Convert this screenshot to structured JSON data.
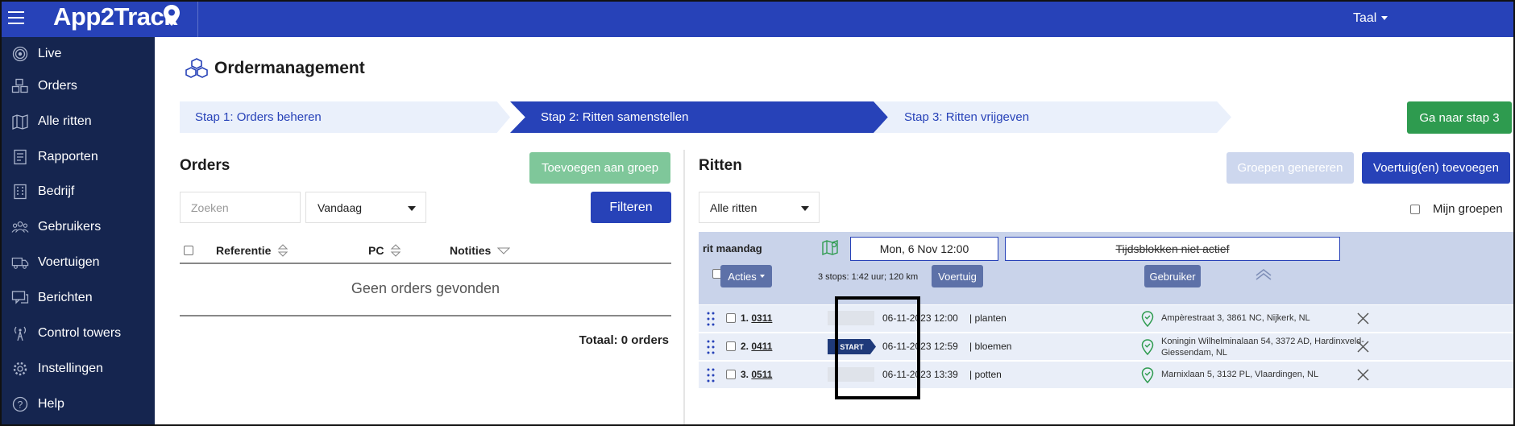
{
  "app": {
    "brand": "App2Track",
    "language_label": "Taal"
  },
  "sidebar": {
    "items": [
      {
        "label": "Live",
        "icon": "live-icon"
      },
      {
        "label": "Orders",
        "icon": "orders-icon"
      },
      {
        "label": "Alle ritten",
        "icon": "map-icon"
      },
      {
        "label": "Rapporten",
        "icon": "reports-icon"
      },
      {
        "label": "Bedrijf",
        "icon": "building-icon"
      },
      {
        "label": "Gebruikers",
        "icon": "users-icon"
      },
      {
        "label": "Voertuigen",
        "icon": "truck-icon"
      },
      {
        "label": "Berichten",
        "icon": "messages-icon"
      },
      {
        "label": "Control towers",
        "icon": "tower-icon"
      },
      {
        "label": "Instellingen",
        "icon": "gear-icon"
      },
      {
        "label": "Help",
        "icon": "help-icon"
      }
    ]
  },
  "page": {
    "title": "Ordermanagement"
  },
  "stepper": {
    "step1": "Stap 1: Orders beheren",
    "step2": "Stap 2: Ritten samenstellen",
    "step3": "Stap 3: Ritten vrijgeven",
    "next_button": "Ga naar stap 3",
    "active": 2
  },
  "orders": {
    "title": "Orders",
    "add_group_button": "Toevoegen aan groep",
    "search_placeholder": "Zoeken",
    "date_filter": "Vandaag",
    "filter_button": "Filteren",
    "columns": [
      "Referentie",
      "PC",
      "Notities"
    ],
    "empty_text": "Geen orders gevonden",
    "total": "Totaal: 0 orders"
  },
  "ritten": {
    "title": "Ritten",
    "generate_button": "Groepen genereren",
    "add_vehicle_button": "Voertuig(en) toevoegen",
    "filter": "Alle ritten",
    "my_groups_label": "Mijn groepen",
    "group": {
      "name": "rit maandag",
      "date": "Mon, 6 Nov 12:00",
      "timeblocks": "Tijdsblokken niet actief",
      "actions_button": "Acties",
      "summary": "3 stops: 1:42 uur; 120 km",
      "vehicle_button": "Voertuig",
      "user_button": "Gebruiker"
    },
    "stops": [
      {
        "index": "1.",
        "ref": "0311",
        "badge": "",
        "time": "06-11-2023 12:00",
        "note": "| planten",
        "address": "Ampèrestraat 3, 3861 NC, Nijkerk, NL"
      },
      {
        "index": "2.",
        "ref": "0411",
        "badge": "START",
        "time": "06-11-2023 12:59",
        "note": "| bloemen",
        "address": "Koningin Wilhelminalaan 54, 3372 AD, Hardinxveld-Giessendam, NL"
      },
      {
        "index": "3.",
        "ref": "0511",
        "badge": "",
        "time": "06-11-2023 13:39",
        "note": "| potten",
        "address": "Marnixlaan 5, 3132 PL, Vlaardingen, NL"
      }
    ]
  },
  "colors": {
    "primary": "#2742b8",
    "sidebar": "#15254f",
    "success": "#2e9b4f",
    "pin": "#2e9b4f"
  }
}
